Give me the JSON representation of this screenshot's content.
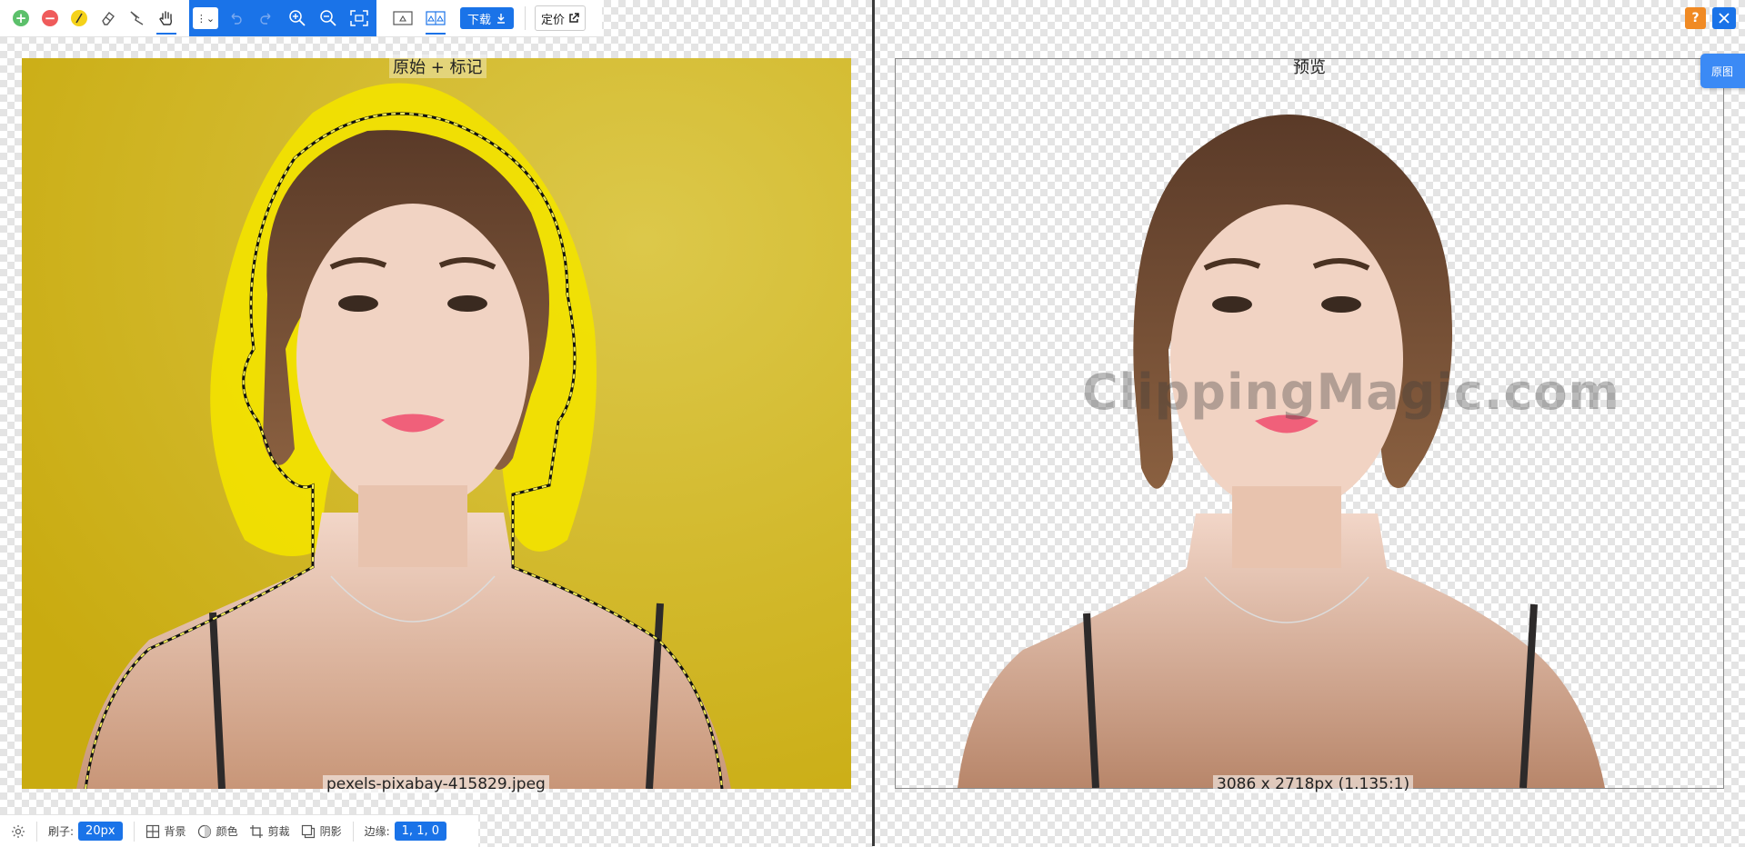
{
  "toolbar": {
    "tools": [
      {
        "name": "add-foreground-icon",
        "color": "#4caf50"
      },
      {
        "name": "remove-background-icon",
        "color": "#f44336"
      },
      {
        "name": "hair-brush-icon",
        "color": "#f5d21a"
      },
      {
        "name": "eraser-icon"
      },
      {
        "name": "scalpel-icon"
      },
      {
        "name": "hand-pan-icon",
        "active": true
      }
    ],
    "download_label": "下载",
    "pricing_label": "定价"
  },
  "left_panel": {
    "caption": "原始 + 标记",
    "filename": "pexels-pixabay-415829.jpeg",
    "bg_color": "#d4b820"
  },
  "right_panel": {
    "caption": "预览",
    "dimensions": "3086 x 2718px (1.135:1)",
    "watermark": "ClippingMagic.com"
  },
  "top_right": {
    "help_label": "?",
    "close_icon": "close-icon",
    "original_tab_label": "原图"
  },
  "bottom_bar": {
    "brush_label": "刷子:",
    "brush_value": "20px",
    "background_label": "背景",
    "color_label": "颜色",
    "crop_label": "剪裁",
    "shadow_label": "阴影",
    "edges_label": "边缘:",
    "edges_value": "1, 1, 0"
  },
  "colors": {
    "accent": "#1a73e8",
    "help": "#f08a24",
    "mark_yellow": "#f2e200",
    "left_bg": "#d4b820"
  }
}
